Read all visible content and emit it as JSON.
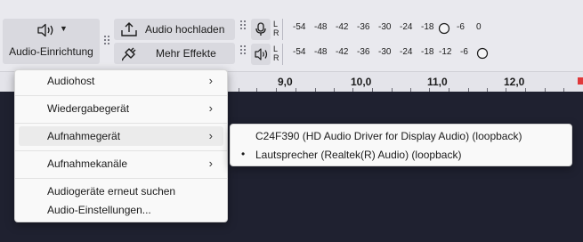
{
  "toolbar": {
    "audio_setup_label": "Audio-Einrichtung",
    "upload_label": "Audio hochladen",
    "effects_label": "Mehr Effekte",
    "record_meter": {
      "left": "L",
      "right": "R",
      "ticks": [
        "-54",
        "-48",
        "-42",
        "-36",
        "-30",
        "-24",
        "-18",
        "-6",
        "0"
      ]
    },
    "play_meter": {
      "left": "L",
      "right": "R",
      "ticks": [
        "-54",
        "-48",
        "-42",
        "-36",
        "-30",
        "-24",
        "-18",
        "-12",
        "-6"
      ]
    }
  },
  "ruler": {
    "labels": [
      "9,0",
      "10,0",
      "11,0",
      "12,0"
    ]
  },
  "menu": {
    "items": [
      {
        "label": "Audiohost",
        "arrow": "›"
      },
      {
        "label": "Wiedergabegerät",
        "arrow": "›"
      },
      {
        "label": "Aufnahmegerät",
        "arrow": "›"
      },
      {
        "label": "Aufnahmekanäle",
        "arrow": "›"
      },
      {
        "label": "Audiogeräte erneut suchen"
      },
      {
        "label": "Audio-Einstellungen..."
      }
    ]
  },
  "submenu": {
    "items": [
      {
        "label": "C24F390 (HD Audio Driver for Display Audio) (loopback)"
      },
      {
        "label": "Lautsprecher (Realtek(R) Audio) (loopback)",
        "bullet": "•"
      }
    ]
  }
}
